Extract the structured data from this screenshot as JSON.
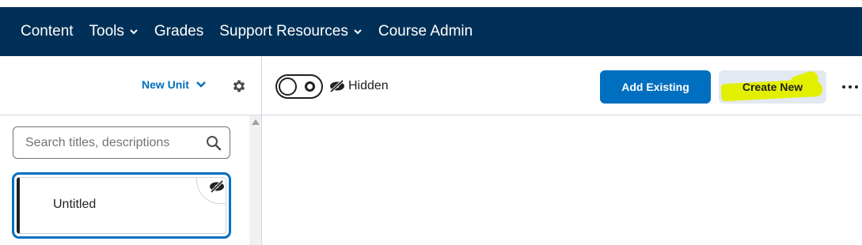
{
  "nav": {
    "items": [
      {
        "label": "Content",
        "has_menu": false
      },
      {
        "label": "Tools",
        "has_menu": true
      },
      {
        "label": "Grades",
        "has_menu": false
      },
      {
        "label": "Support Resources",
        "has_menu": true
      },
      {
        "label": "Course Admin",
        "has_menu": false
      }
    ]
  },
  "sidebar": {
    "new_unit_label": "New Unit",
    "search_placeholder": "Search titles, descriptions",
    "card": {
      "title": "Untitled",
      "visibility_icon": "eye-slash-icon"
    }
  },
  "toolbar": {
    "visibility_label": "Hidden",
    "add_existing_label": "Add Existing",
    "create_new_label": "Create New",
    "more_icon": "more-horizontal-icon"
  },
  "colors": {
    "header_bg": "#003057",
    "accent": "#006fbf",
    "highlight": "#e2f000"
  }
}
